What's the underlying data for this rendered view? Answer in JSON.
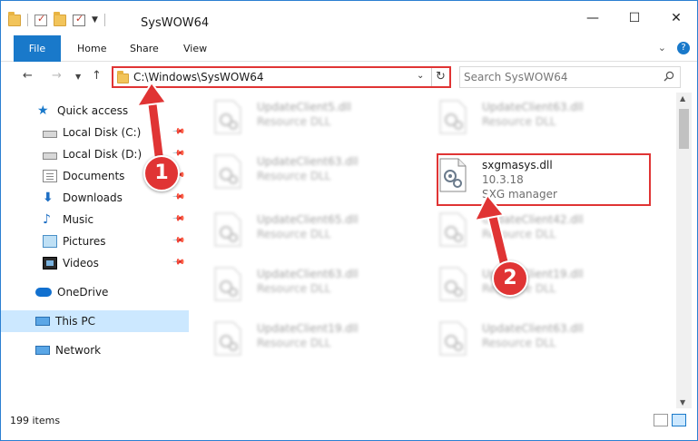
{
  "window": {
    "title": "SysWOW64",
    "caption": {
      "minimize": "—",
      "maximize": "☐",
      "close": "✕"
    }
  },
  "ribbon": {
    "tabs": [
      "File",
      "Home",
      "Share",
      "View"
    ],
    "expand": "⌄",
    "help": "?"
  },
  "address": {
    "path": "C:\\Windows\\SysWOW64",
    "search_placeholder": "Search SysWOW64"
  },
  "nav": {
    "back": "←",
    "forward": "→",
    "recent": "▼",
    "up": "↑",
    "items": [
      {
        "label": "Quick access",
        "icon": "star-icon"
      },
      {
        "label": "Local Disk (C:)",
        "icon": "disk-icon",
        "pinned": true
      },
      {
        "label": "Local Disk (D:)",
        "icon": "disk-icon",
        "pinned": true
      },
      {
        "label": "Documents",
        "icon": "documents-icon",
        "pinned": true
      },
      {
        "label": "Downloads",
        "icon": "downloads-icon",
        "pinned": true
      },
      {
        "label": "Music",
        "icon": "music-icon",
        "pinned": true
      },
      {
        "label": "Pictures",
        "icon": "pictures-icon",
        "pinned": true
      },
      {
        "label": "Videos",
        "icon": "videos-icon",
        "pinned": true
      },
      {
        "label": "OneDrive",
        "icon": "cloud-icon"
      },
      {
        "label": "This PC",
        "icon": "computer-icon",
        "selected": true
      },
      {
        "label": "Network",
        "icon": "network-icon"
      }
    ]
  },
  "files": [
    {
      "name": "UpdateClient5.dll",
      "sub1": "Resource DLL",
      "blurred": true
    },
    {
      "name": "UpdateClient63.dll",
      "sub1": "Resource DLL",
      "blurred": true
    },
    {
      "name": "UpdateClient63.dll",
      "sub1": "Resource DLL",
      "blurred": true
    },
    {
      "name": "sxgmasys.dll",
      "sub1": "10.3.18",
      "sub2": "SXG manager",
      "blurred": false
    },
    {
      "name": "UpdateClient65.dll",
      "sub1": "Resource DLL",
      "blurred": true
    },
    {
      "name": "UpdateClient42.dll",
      "sub1": "Resource DLL",
      "blurred": true
    },
    {
      "name": "UpdateClient63.dll",
      "sub1": "Resource DLL",
      "blurred": true
    },
    {
      "name": "UpdateClient19.dll",
      "sub1": "Resource DLL",
      "blurred": true
    },
    {
      "name": "UpdateClient19.dll",
      "sub1": "Resource DLL",
      "blurred": true
    },
    {
      "name": "UpdateClient63.dll",
      "sub1": "Resource DLL",
      "blurred": true
    }
  ],
  "status": {
    "item_count": "199 items"
  },
  "annotations": {
    "step1": "1",
    "step2": "2",
    "color": "#e03434"
  },
  "colors": {
    "accent": "#1979ca",
    "highlight": "#e03434",
    "selected_bg": "#cce8ff"
  }
}
